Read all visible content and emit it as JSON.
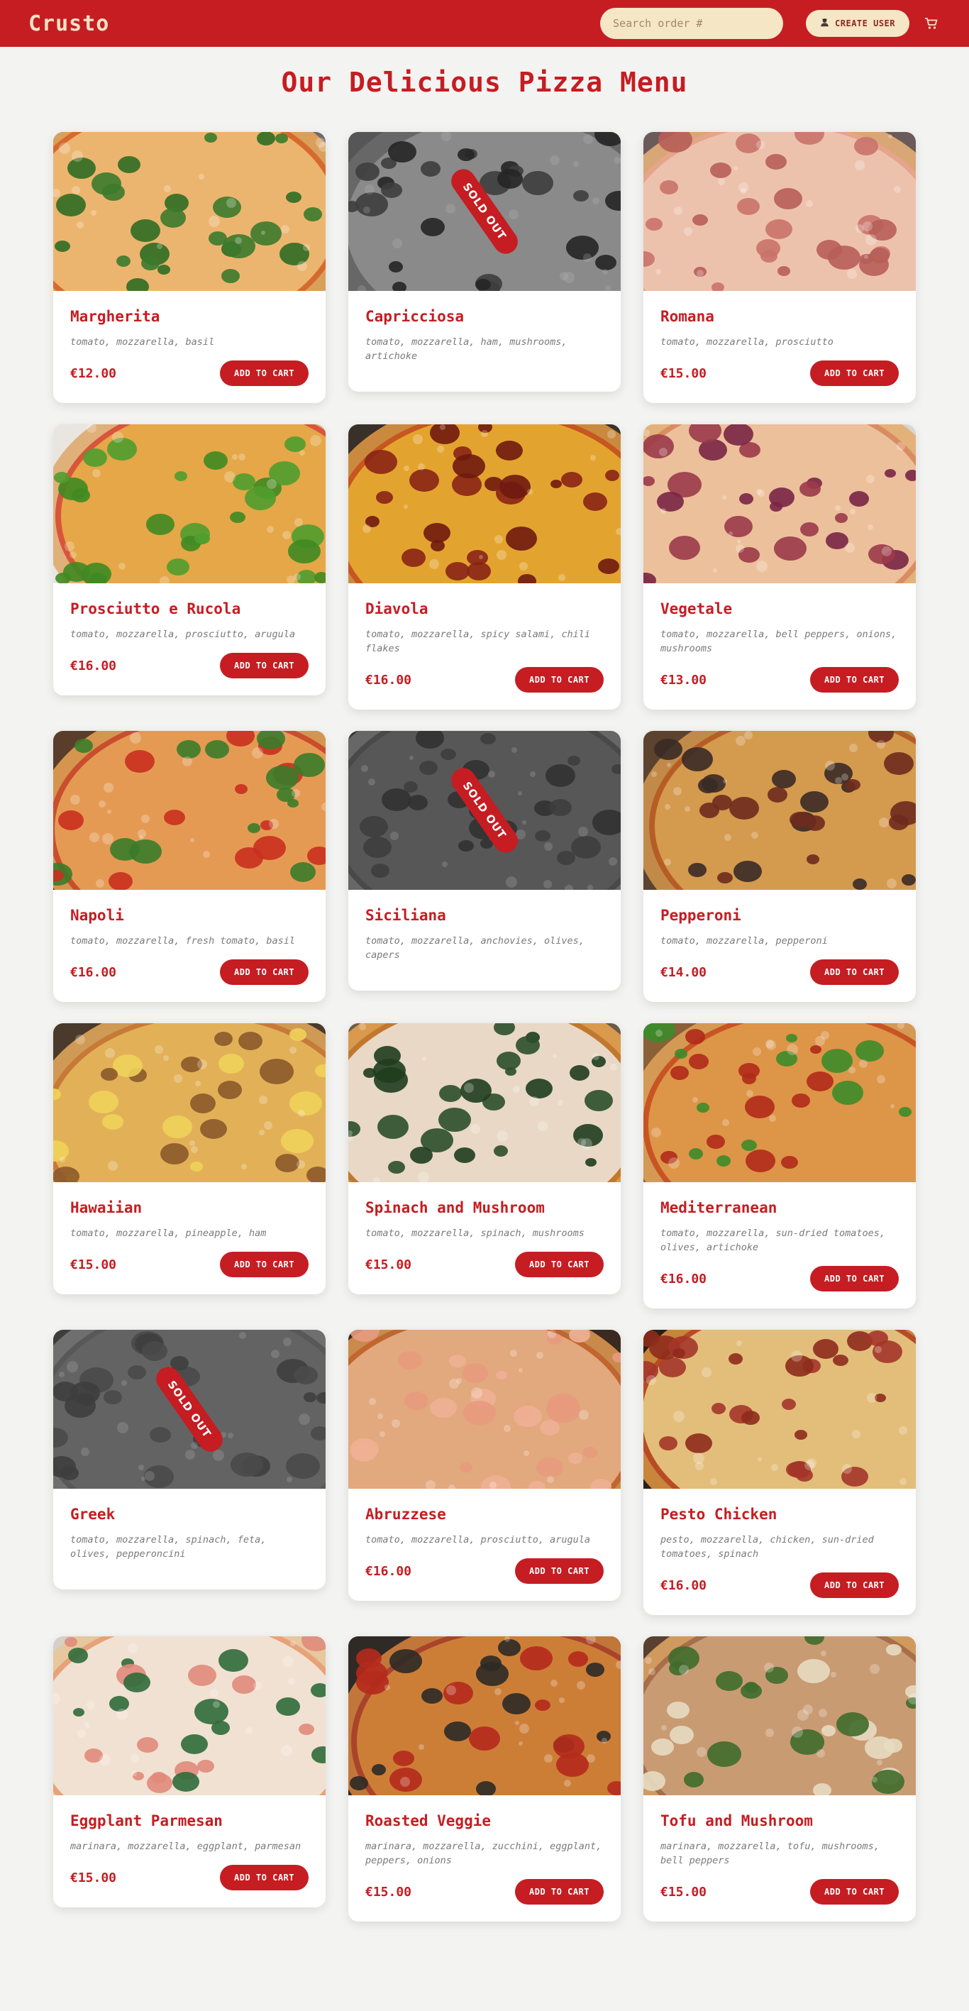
{
  "header": {
    "logo": "Crusto",
    "search_placeholder": "Search order #",
    "create_user_label": "CREATE USER",
    "create_user_icon": "user-icon",
    "cart_icon": "cart-icon"
  },
  "page_title": "Our Delicious Pizza Menu",
  "colors": {
    "brand": "#c51d22",
    "cream": "#f5e6c6",
    "background": "#f3f3f1"
  },
  "sold_out_label": "SOLD OUT",
  "add_to_cart_label": "ADD TO CART",
  "pizzas": [
    {
      "name": "Margherita",
      "ingredients": "tomato, mozzarella, basil",
      "price": "€12.00",
      "sold_out": false
    },
    {
      "name": "Capricciosa",
      "ingredients": "tomato, mozzarella, ham, mushrooms, artichoke",
      "price": "",
      "sold_out": true
    },
    {
      "name": "Romana",
      "ingredients": "tomato, mozzarella, prosciutto",
      "price": "€15.00",
      "sold_out": false
    },
    {
      "name": "Prosciutto e Rucola",
      "ingredients": "tomato, mozzarella, prosciutto, arugula",
      "price": "€16.00",
      "sold_out": false
    },
    {
      "name": "Diavola",
      "ingredients": "tomato, mozzarella, spicy salami, chili flakes",
      "price": "€16.00",
      "sold_out": false
    },
    {
      "name": "Vegetale",
      "ingredients": "tomato, mozzarella, bell peppers, onions, mushrooms",
      "price": "€13.00",
      "sold_out": false
    },
    {
      "name": "Napoli",
      "ingredients": "tomato, mozzarella, fresh tomato, basil",
      "price": "€16.00",
      "sold_out": false
    },
    {
      "name": "Siciliana",
      "ingredients": "tomato, mozzarella, anchovies, olives, capers",
      "price": "",
      "sold_out": true
    },
    {
      "name": "Pepperoni",
      "ingredients": "tomato, mozzarella, pepperoni",
      "price": "€14.00",
      "sold_out": false
    },
    {
      "name": "Hawaiian",
      "ingredients": "tomato, mozzarella, pineapple, ham",
      "price": "€15.00",
      "sold_out": false
    },
    {
      "name": "Spinach and Mushroom",
      "ingredients": "tomato, mozzarella, spinach, mushrooms",
      "price": "€15.00",
      "sold_out": false
    },
    {
      "name": "Mediterranean",
      "ingredients": "tomato, mozzarella, sun-dried tomatoes, olives, artichoke",
      "price": "€16.00",
      "sold_out": false
    },
    {
      "name": "Greek",
      "ingredients": "tomato, mozzarella, spinach, feta, olives, pepperoncini",
      "price": "",
      "sold_out": true
    },
    {
      "name": "Abruzzese",
      "ingredients": "tomato, mozzarella, prosciutto, arugula",
      "price": "€16.00",
      "sold_out": false
    },
    {
      "name": "Pesto Chicken",
      "ingredients": "pesto, mozzarella, chicken, sun-dried tomatoes, spinach",
      "price": "€16.00",
      "sold_out": false
    },
    {
      "name": "Eggplant Parmesan",
      "ingredients": "marinara, mozzarella, eggplant, parmesan",
      "price": "€15.00",
      "sold_out": false
    },
    {
      "name": "Roasted Veggie",
      "ingredients": "marinara, mozzarella, zucchini, eggplant, peppers, onions",
      "price": "€15.00",
      "sold_out": false
    },
    {
      "name": "Tofu and Mushroom",
      "ingredients": "marinara, mozzarella, tofu, mushrooms, bell peppers",
      "price": "€15.00",
      "sold_out": false
    }
  ]
}
